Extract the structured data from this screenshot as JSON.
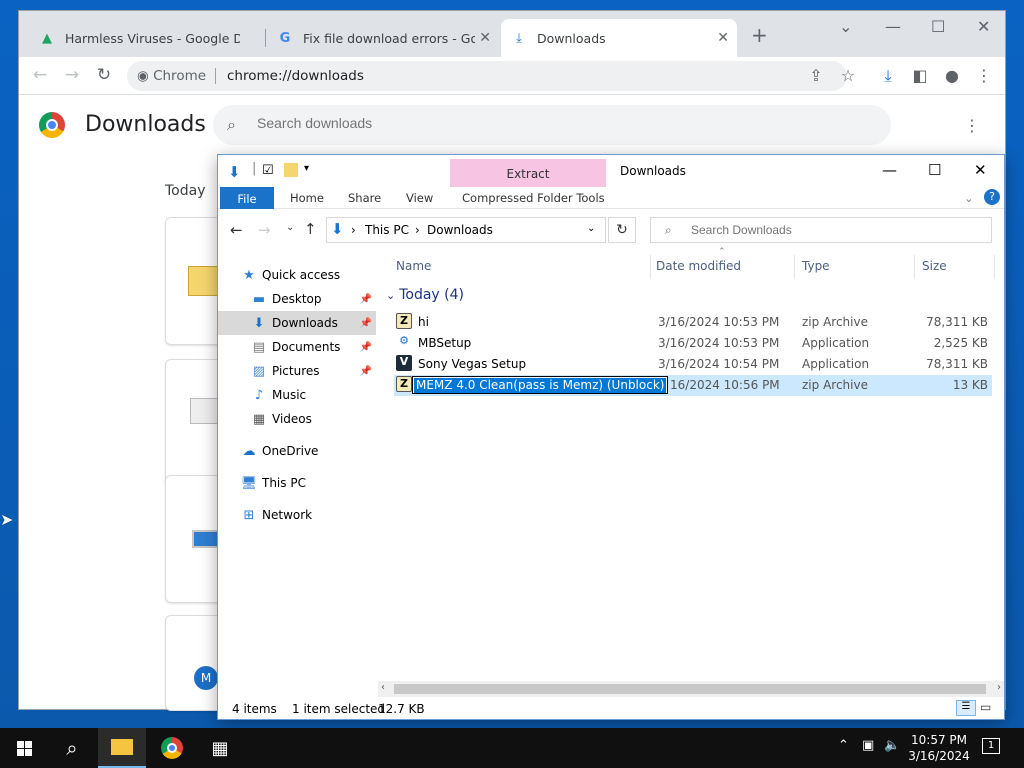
{
  "chrome": {
    "tabs": [
      {
        "title": "Harmless Viruses - Google Drive",
        "icon": "google-drive-icon"
      },
      {
        "title": "Fix file download errors - Google",
        "icon": "google-g-icon"
      },
      {
        "title": "Downloads",
        "icon": "download-icon"
      }
    ],
    "omnibox": {
      "site": "Chrome",
      "url": "chrome://downloads"
    },
    "page": {
      "title": "Downloads",
      "search_placeholder": "Search downloads",
      "date_group": "Today"
    }
  },
  "explorer": {
    "title": "Downloads",
    "context_tab": "Extract",
    "ribbon_tabs": [
      "File",
      "Home",
      "Share",
      "View",
      "Compressed Folder Tools"
    ],
    "breadcrumb": [
      "This PC",
      "Downloads"
    ],
    "search_placeholder": "Search Downloads",
    "nav": {
      "quick_access": "Quick access",
      "items": [
        "Desktop",
        "Downloads",
        "Documents",
        "Pictures",
        "Music",
        "Videos"
      ],
      "onedrive": "OneDrive",
      "this_pc": "This PC",
      "network": "Network"
    },
    "columns": [
      "Name",
      "Date modified",
      "Type",
      "Size"
    ],
    "group": "Today (4)",
    "files": [
      {
        "name": "hi",
        "date": "3/16/2024 10:53 PM",
        "type": "zip Archive",
        "size": "78,311 KB"
      },
      {
        "name": "MBSetup",
        "date": "3/16/2024 10:53 PM",
        "type": "Application",
        "size": "2,525 KB"
      },
      {
        "name": "Sony Vegas Setup",
        "date": "3/16/2024 10:54 PM",
        "type": "Application",
        "size": "78,311 KB"
      },
      {
        "name": "MEMZ 4.0 Clean(pass is Memz) (Unblock)",
        "date": "16/2024 10:56 PM",
        "type": "zip Archive",
        "size": "13 KB"
      }
    ],
    "status": {
      "items": "4 items",
      "selected": "1 item selected",
      "size": "12.7 KB"
    }
  },
  "taskbar": {
    "time": "10:57 PM",
    "date": "3/16/2024",
    "notification_count": "1"
  },
  "colors": {
    "desktop": "#0b5fb7",
    "explorer_accent": "#1a73c8",
    "context_band": "#f7c4e4",
    "selection": "#cce8ff"
  }
}
